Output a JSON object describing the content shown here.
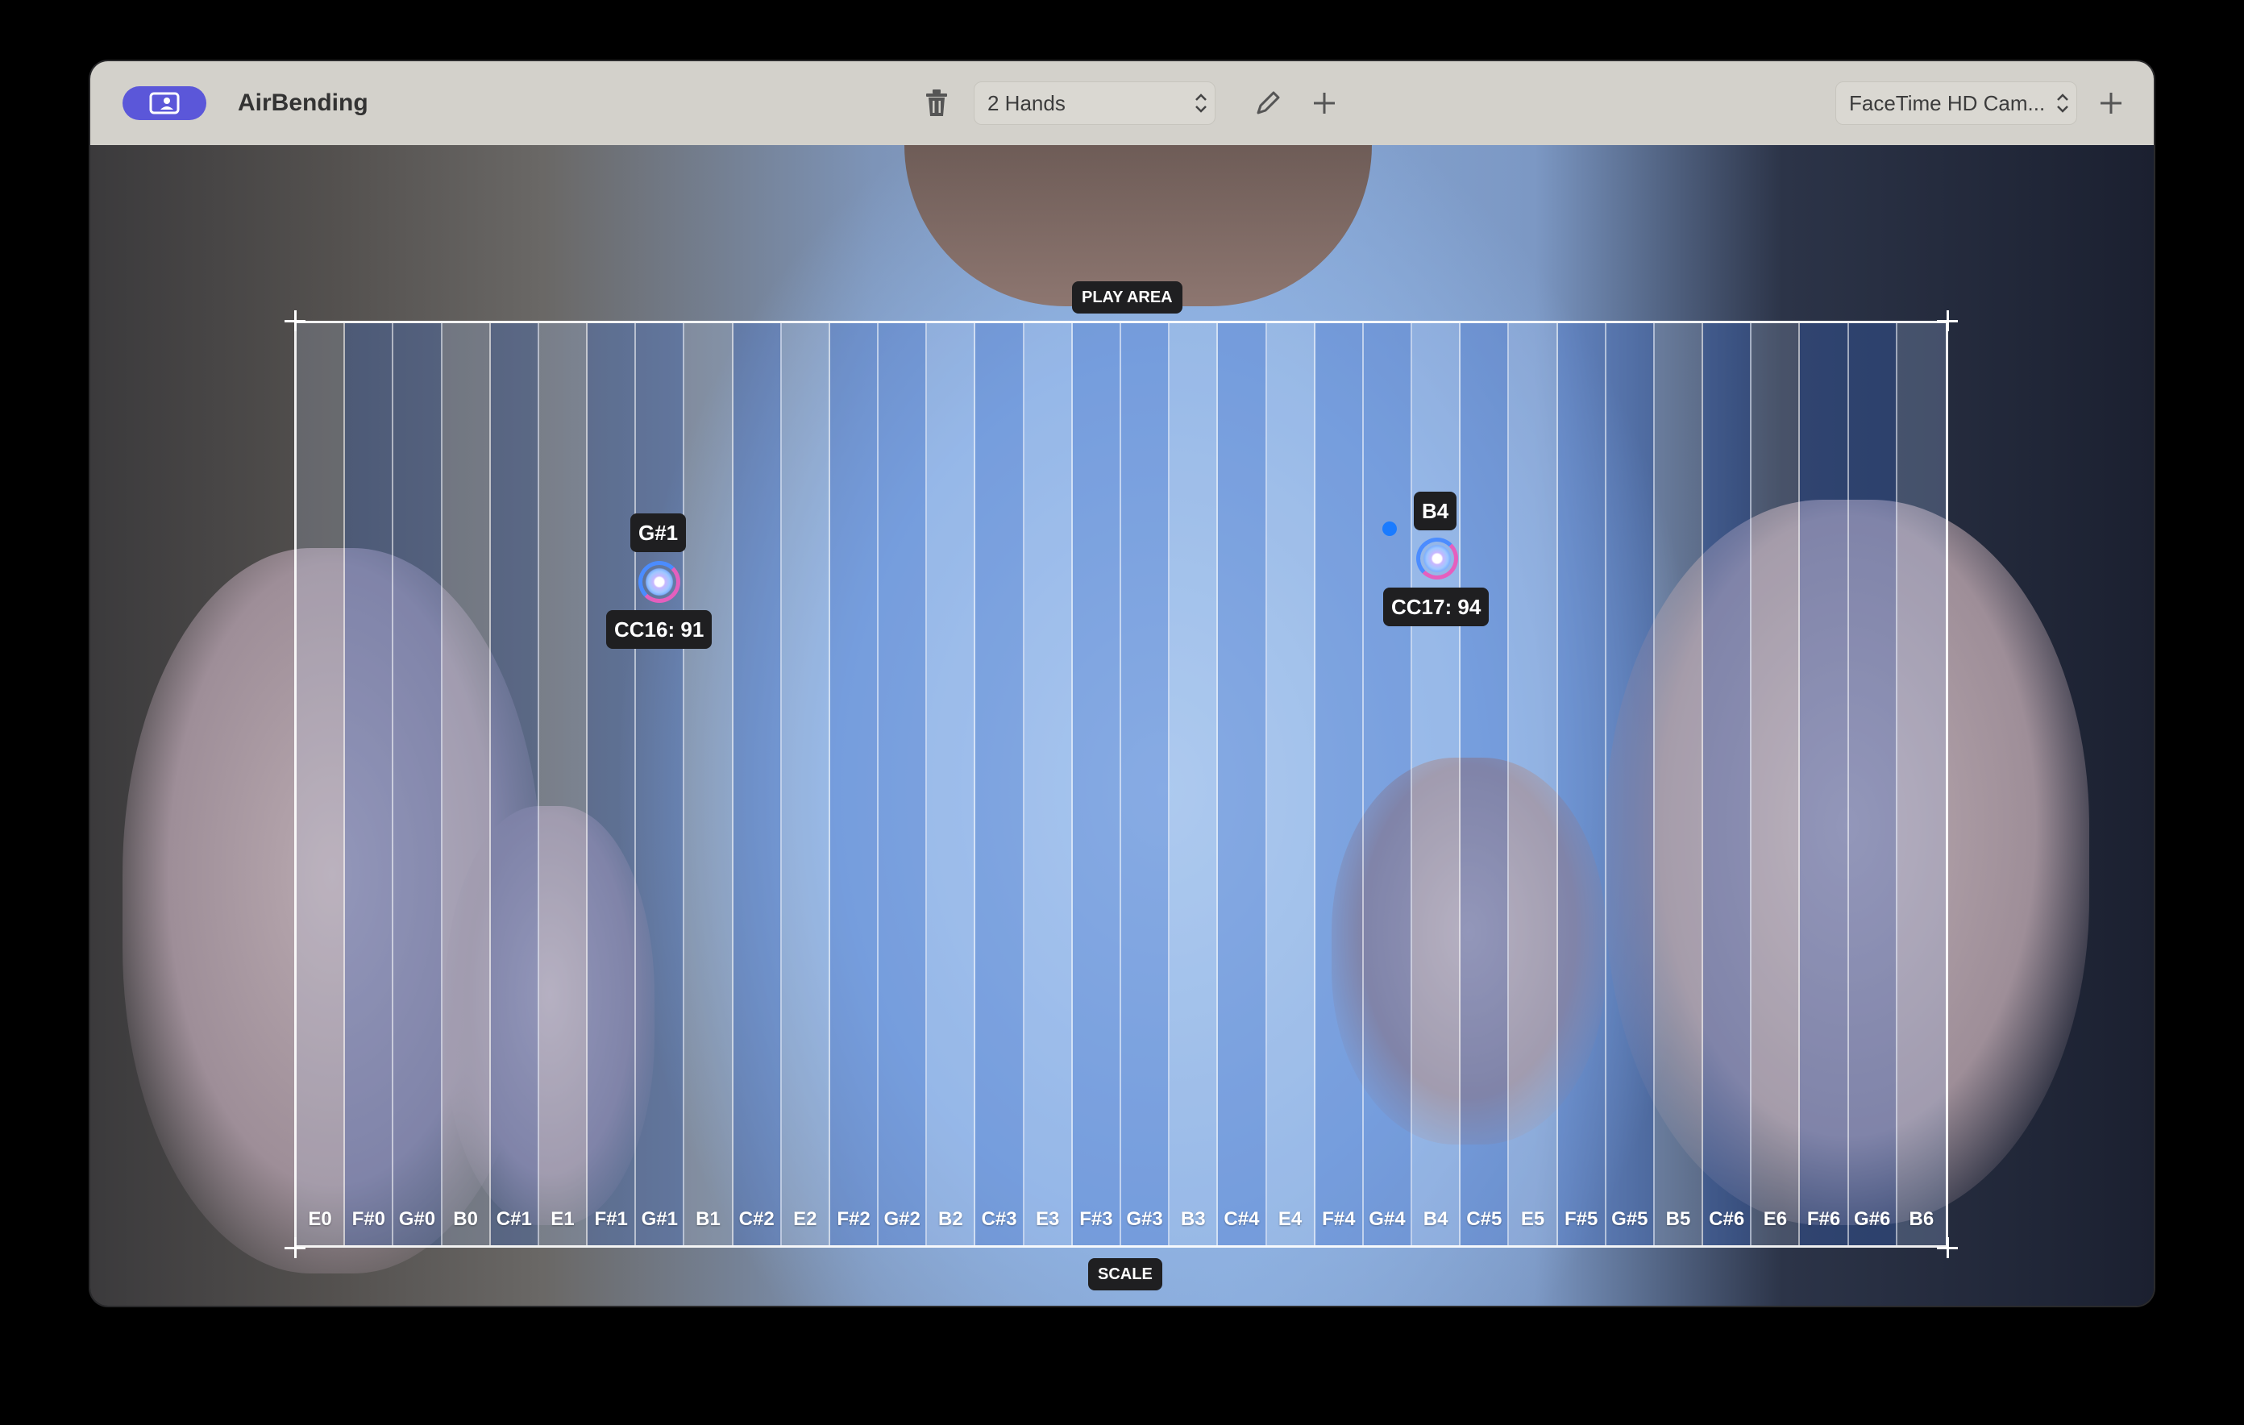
{
  "app": {
    "title": "AirBending"
  },
  "toolbar": {
    "hands_select": "2 Hands",
    "camera_select": "FaceTime HD Cam...",
    "icons": [
      "sidebar-icon",
      "trash-icon",
      "pencil-icon",
      "plus-icon",
      "plus-icon"
    ]
  },
  "overlay": {
    "play_area_label": "PLAY AREA",
    "scale_label": "SCALE",
    "notes": [
      "E0",
      "F#0",
      "G#0",
      "B0",
      "C#1",
      "E1",
      "F#1",
      "G#1",
      "B1",
      "C#2",
      "E2",
      "F#2",
      "G#2",
      "B2",
      "C#3",
      "E3",
      "F#3",
      "G#3",
      "B3",
      "C#4",
      "E4",
      "F#4",
      "G#4",
      "B4",
      "C#5",
      "E5",
      "F#5",
      "G#5",
      "B5",
      "C#6",
      "E6",
      "F#6",
      "G#6",
      "B6"
    ],
    "left_hand": {
      "note": "G#1",
      "cc": "CC16: 91"
    },
    "right_hand": {
      "note": "B4",
      "cc": "CC17: 94"
    }
  },
  "colors": {
    "accent": "#5b57d9",
    "toolbar_bg": "#d3d1cb",
    "cursor_blue": "#4b8cff",
    "cursor_pink": "#e55fbe",
    "tag_bg": "#1f1f21"
  }
}
